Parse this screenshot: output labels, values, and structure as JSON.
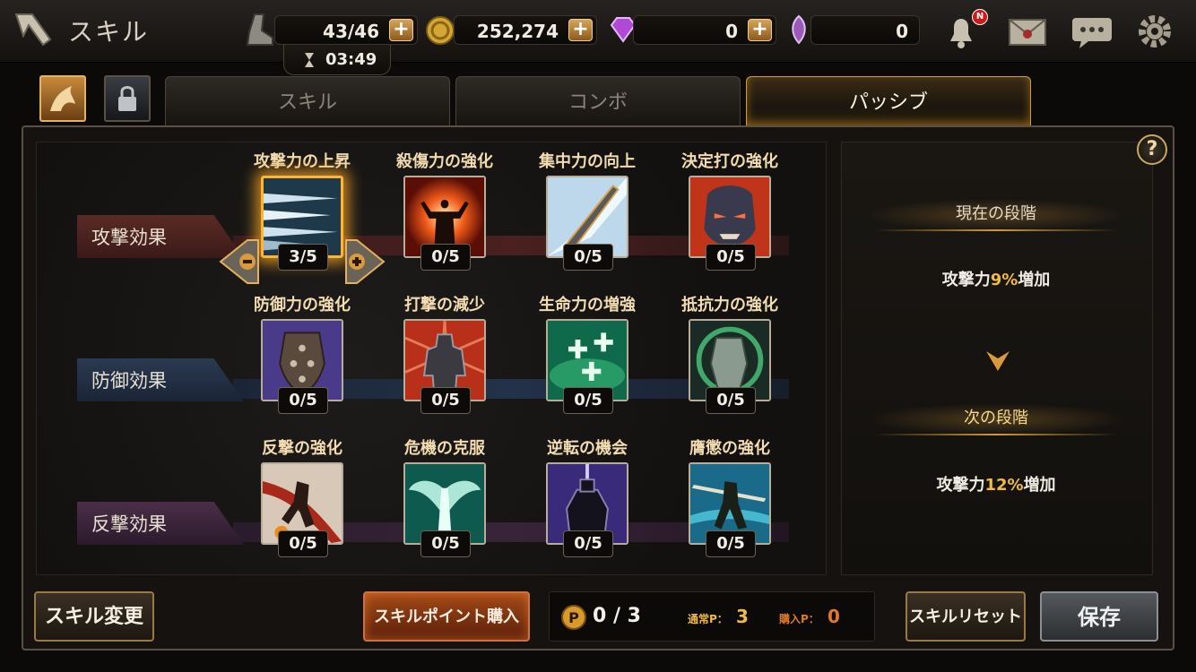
{
  "header": {
    "title": "スキル",
    "stamina": "43/46",
    "stamina_timer": "03:49",
    "gold": "252,274",
    "gems": "0",
    "special": "0",
    "notification_badge": "N"
  },
  "tabs": [
    {
      "label": "スキル",
      "active": false
    },
    {
      "label": "コンボ",
      "active": false
    },
    {
      "label": "パッシブ",
      "active": true
    }
  ],
  "rows": [
    {
      "label": "攻撃効果",
      "skills": [
        {
          "name": "攻撃力の上昇",
          "level": "3/5",
          "icon": "blades-icon",
          "selected": true
        },
        {
          "name": "殺傷力の強化",
          "level": "0/5",
          "icon": "power-burst-icon"
        },
        {
          "name": "集中力の向上",
          "level": "0/5",
          "icon": "sword-strike-icon"
        },
        {
          "name": "決定打の強化",
          "level": "0/5",
          "icon": "rage-face-icon"
        }
      ]
    },
    {
      "label": "防御効果",
      "skills": [
        {
          "name": "防御力の強化",
          "level": "0/5",
          "icon": "spiked-shield-icon"
        },
        {
          "name": "打撃の減少",
          "level": "0/5",
          "icon": "armored-knight-icon"
        },
        {
          "name": "生命力の増強",
          "level": "0/5",
          "icon": "healing-cross-icon"
        },
        {
          "name": "抵抗力の強化",
          "level": "0/5",
          "icon": "resist-aura-icon"
        }
      ]
    },
    {
      "label": "反撃効果",
      "skills": [
        {
          "name": "反撃の強化",
          "level": "0/5",
          "icon": "counter-slash-icon"
        },
        {
          "name": "危機の克服",
          "level": "0/5",
          "icon": "angel-wings-icon"
        },
        {
          "name": "逆転の機会",
          "level": "0/5",
          "icon": "dark-knight-icon"
        },
        {
          "name": "膺懲の強化",
          "level": "0/5",
          "icon": "lance-warrior-icon"
        }
      ]
    }
  ],
  "info": {
    "current_stage_label": "現在の段階",
    "current_prefix": "攻撃力",
    "current_value": "9%",
    "current_suffix": "増加",
    "next_stage_label": "次の段階",
    "next_prefix": "攻撃力",
    "next_value": "12%",
    "next_suffix": "増加",
    "help": "?"
  },
  "footer": {
    "change_skill": "スキル変更",
    "buy_points": "スキルポイント購入",
    "points": "0 / 3",
    "normal_label": "通常P：",
    "normal_value": "3",
    "purchase_label": "購入P：",
    "purchase_value": "0",
    "reset": "スキルリセット",
    "save": "保存"
  },
  "colors": {
    "accent": "#f0b94a",
    "skill_name": "#f2dcb0",
    "normal_p": "#f0b94a",
    "purchase_p": "#e07a2a"
  }
}
